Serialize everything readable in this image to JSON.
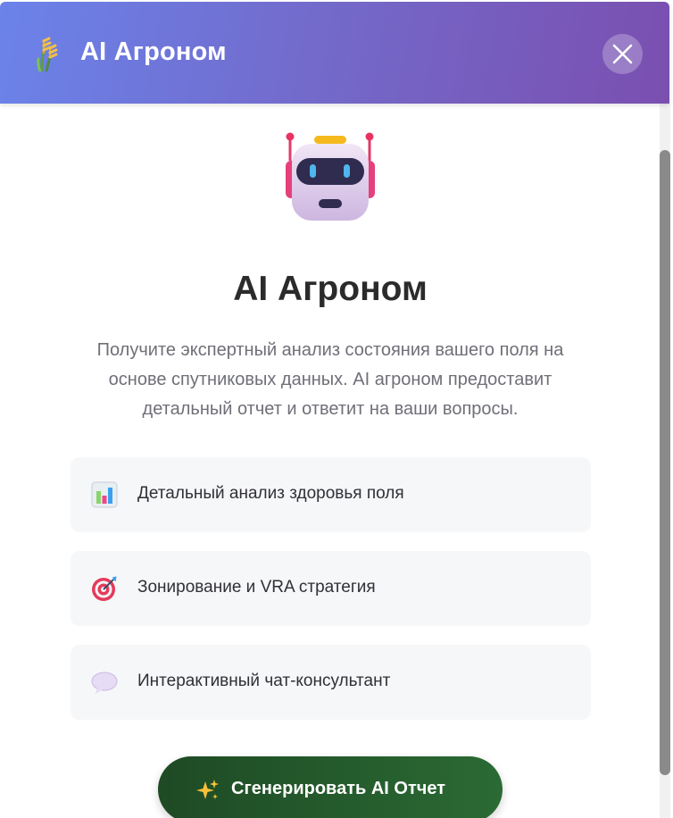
{
  "header": {
    "icon": "wheat-icon",
    "title": "AI Агроном",
    "close_icon": "close-icon"
  },
  "hero": {
    "icon": "robot-icon",
    "title": "AI Агроном",
    "description": "Получите экспертный анализ состояния вашего поля на основе спутниковых данных. AI агроном предоставит детальный отчет и ответит на ваши вопросы."
  },
  "features": [
    {
      "icon": "bar-chart-icon",
      "label": "Детальный анализ здоровья поля"
    },
    {
      "icon": "target-icon",
      "label": "Зонирование и VRA стратегия"
    },
    {
      "icon": "speech-bubble-icon",
      "label": "Интерактивный чат-консультант"
    }
  ],
  "action": {
    "icon": "sparkles-icon",
    "label": "Сгенерировать AI Отчет"
  },
  "colors": {
    "header_gradient_start": "#6b83ea",
    "header_gradient_end": "#7a4fb0",
    "button_dark_green": "#1e4a24",
    "button_green": "#2b6a34",
    "feature_bg": "#f6f7f9"
  }
}
